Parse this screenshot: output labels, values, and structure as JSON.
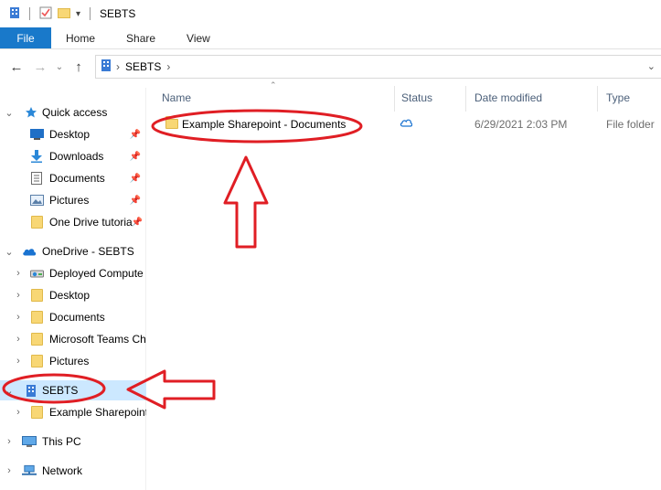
{
  "window": {
    "title": "SEBTS"
  },
  "ribbon": {
    "tabs": [
      "File",
      "Home",
      "Share",
      "View"
    ]
  },
  "address": {
    "path": [
      "SEBTS"
    ]
  },
  "nav": {
    "quick_access_label": "Quick access",
    "quick_access_items": [
      {
        "label": "Desktop",
        "icon": "desktop-icon",
        "pinned": true
      },
      {
        "label": "Downloads",
        "icon": "downloads-icon",
        "pinned": true
      },
      {
        "label": "Documents",
        "icon": "documents-icon",
        "pinned": true
      },
      {
        "label": "Pictures",
        "icon": "pictures-icon",
        "pinned": true
      },
      {
        "label": "One Drive tutoria",
        "icon": "folder-icon",
        "pinned": true
      }
    ],
    "onedrive_label": "OneDrive - SEBTS",
    "onedrive_items": [
      {
        "label": "Deployed Compute",
        "icon": "network-drive-icon"
      },
      {
        "label": "Desktop",
        "icon": "folder-icon"
      },
      {
        "label": "Documents",
        "icon": "folder-icon"
      },
      {
        "label": "Microsoft Teams Ch",
        "icon": "folder-icon"
      },
      {
        "label": "Pictures",
        "icon": "folder-icon"
      }
    ],
    "sebts_label": "SEBTS",
    "sebts_children": [
      {
        "label": "Example Sharepoint",
        "icon": "folder-icon"
      }
    ],
    "this_pc_label": "This PC",
    "network_label": "Network"
  },
  "content": {
    "columns": {
      "name": "Name",
      "status": "Status",
      "date": "Date modified",
      "type": "Type"
    },
    "rows": [
      {
        "name": "Example Sharepoint - Documents",
        "status": "cloud",
        "date": "6/29/2021 2:03 PM",
        "type": "File folder"
      }
    ]
  },
  "colors": {
    "accent": "#1979ca",
    "selection": "#cce8ff",
    "annotation": "#e01e24",
    "folder": "#f8d775"
  }
}
